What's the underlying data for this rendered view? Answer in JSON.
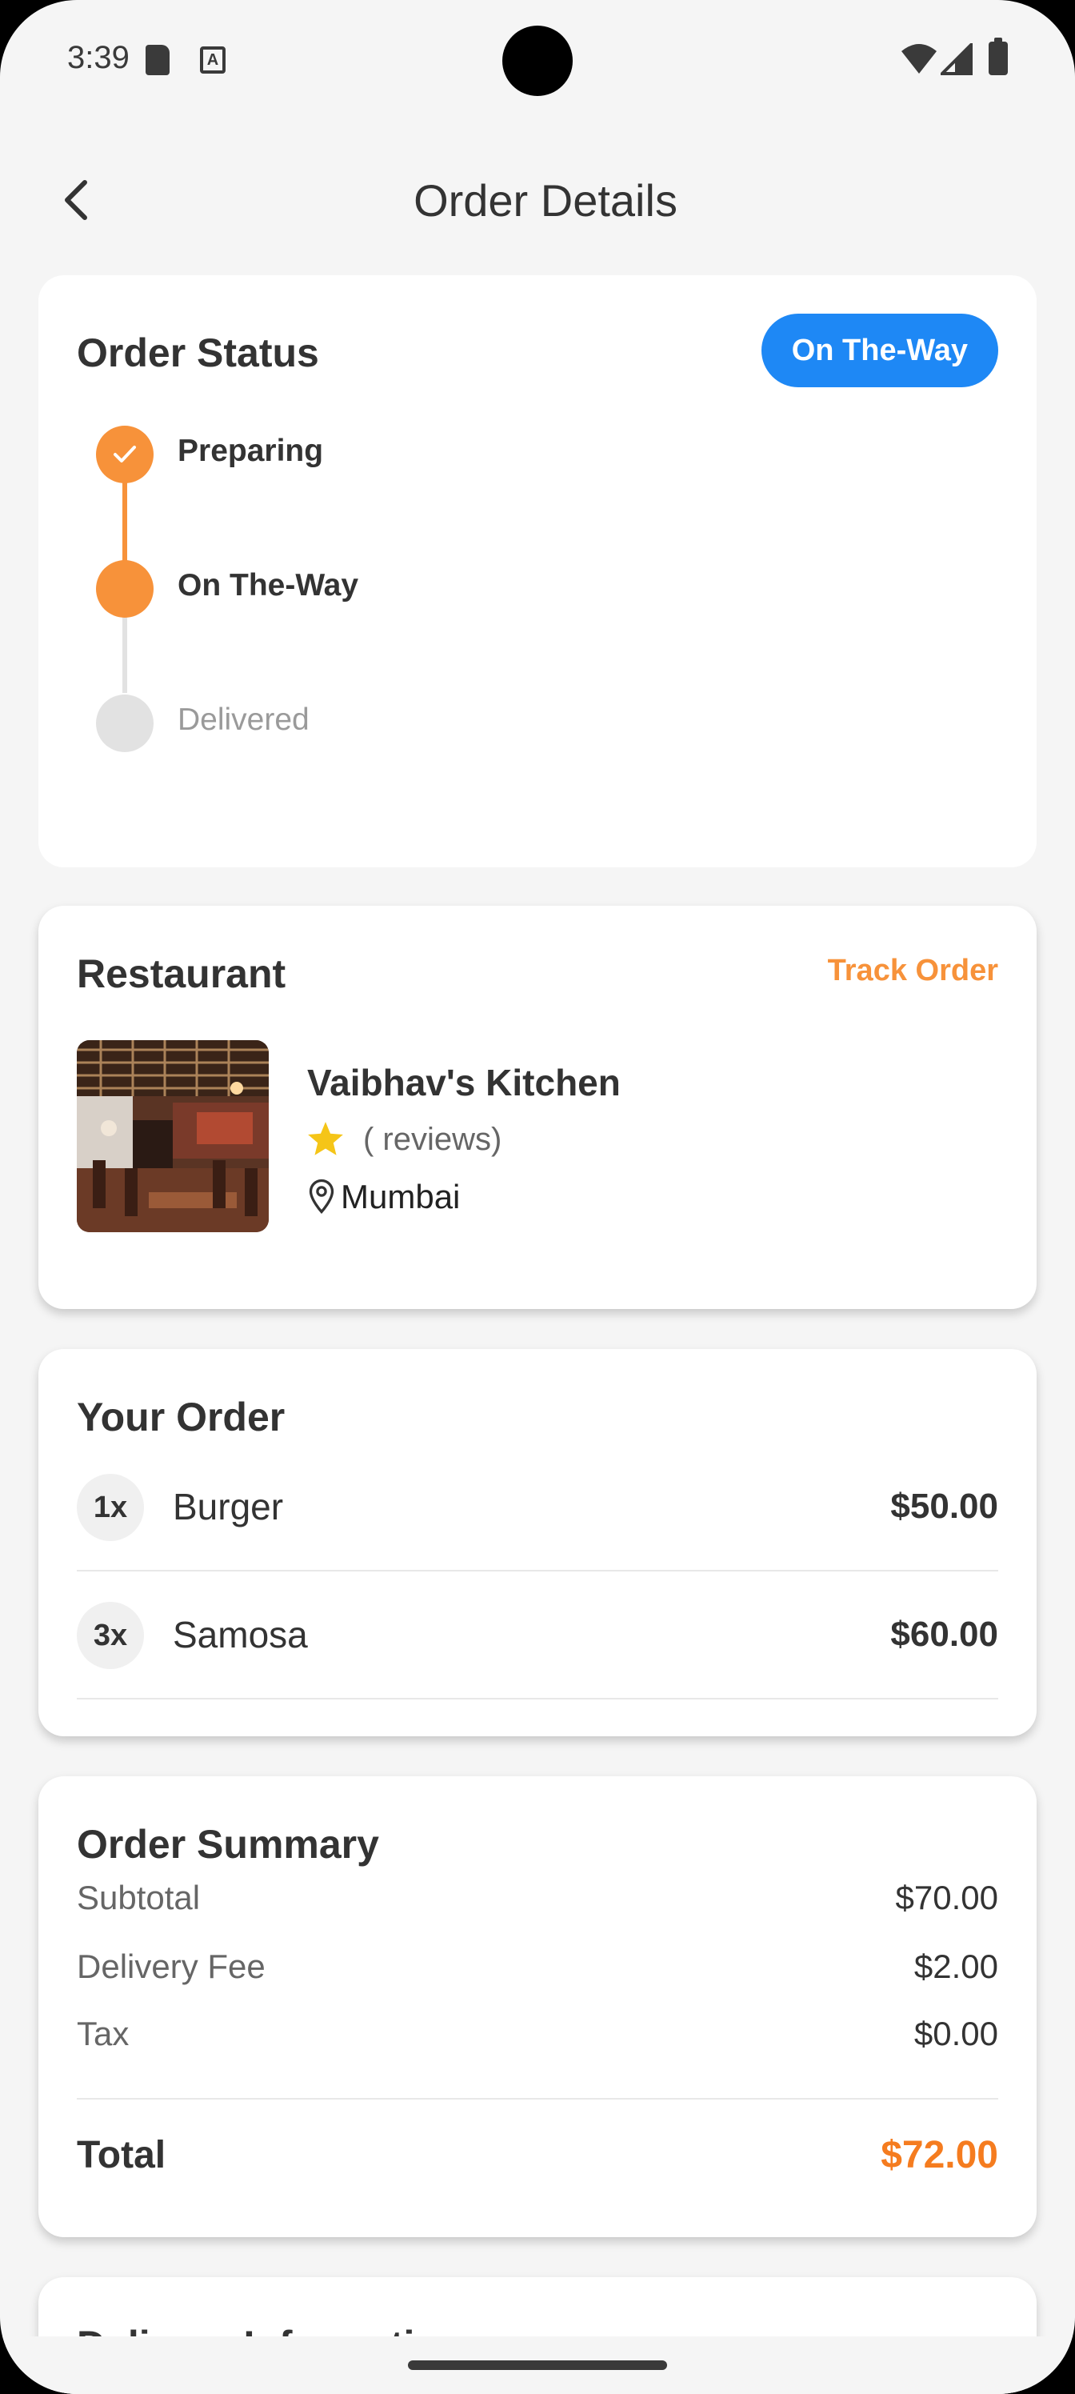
{
  "status_bar": {
    "time": "3:39"
  },
  "header": {
    "title": "Order Details"
  },
  "order_status": {
    "title": "Order Status",
    "badge": "On The-Way",
    "steps": [
      {
        "label": "Preparing",
        "state": "done"
      },
      {
        "label": "On The-Way",
        "state": "active"
      },
      {
        "label": "Delivered",
        "state": "pending"
      }
    ]
  },
  "restaurant": {
    "title": "Restaurant",
    "track_label": "Track Order",
    "name": "Vaibhav's Kitchen",
    "reviews": "( reviews)",
    "location": "Mumbai"
  },
  "your_order": {
    "title": "Your Order",
    "items": [
      {
        "qty": "1x",
        "name": "Burger",
        "price": "$50.00"
      },
      {
        "qty": "3x",
        "name": "Samosa",
        "price": "$60.00"
      }
    ]
  },
  "summary": {
    "title": "Order Summary",
    "rows": [
      {
        "label": "Subtotal",
        "value": "$70.00"
      },
      {
        "label": "Delivery Fee",
        "value": "$2.00"
      },
      {
        "label": "Tax",
        "value": "$0.00"
      }
    ],
    "total_label": "Total",
    "total_value": "$72.00"
  },
  "delivery": {
    "title": "Delivery Information"
  },
  "colors": {
    "accent": "#f7923a",
    "badge": "#1e88f5",
    "total": "#f57c1f"
  }
}
